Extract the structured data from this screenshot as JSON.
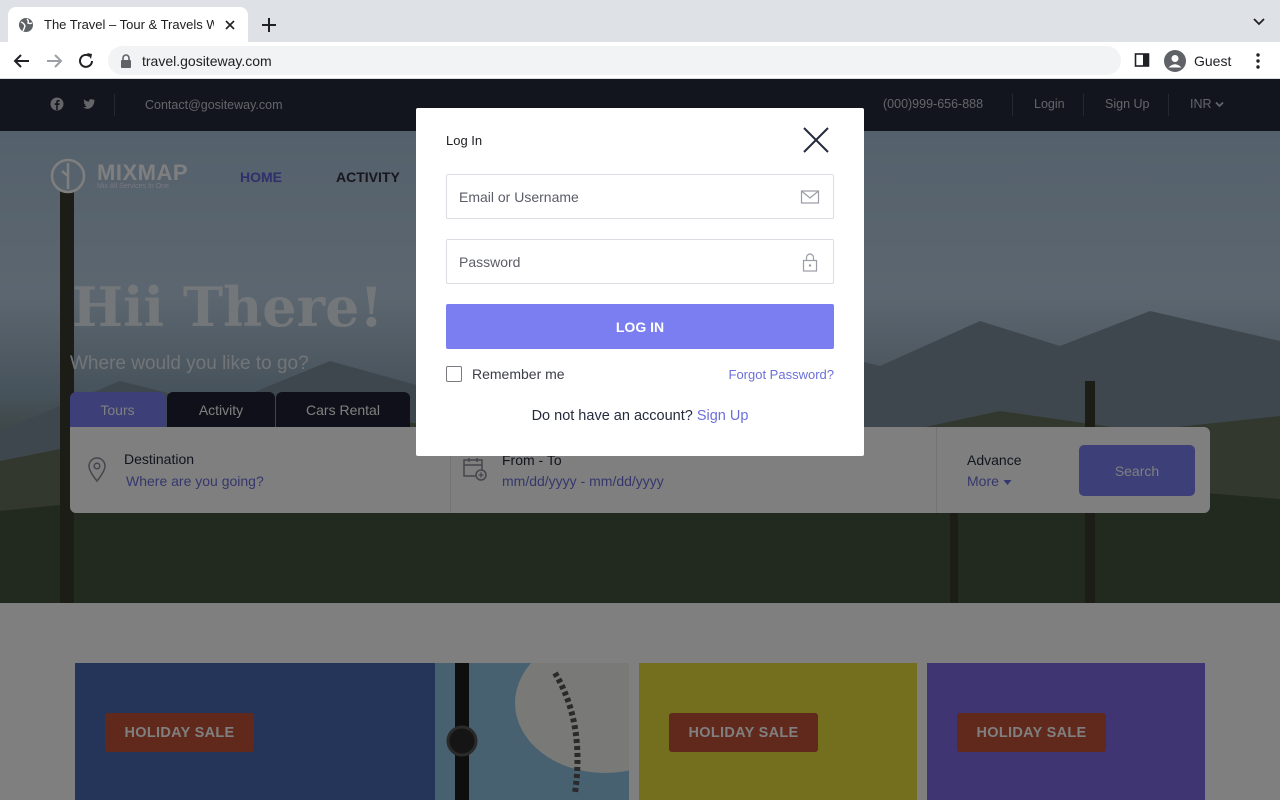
{
  "browser": {
    "tab_title": "The Travel – Tour & Travels We",
    "url": "travel.gositeway.com",
    "profile_label": "Guest"
  },
  "topbar": {
    "contact": "Contact@gositeway.com",
    "phone": "(000)999-656-888",
    "login": "Login",
    "signup": "Sign Up",
    "currency": "INR"
  },
  "header": {
    "logo_name": "MIXMAP",
    "logo_tagline": "Mix All Services In One",
    "menu": [
      "HOME",
      "ACTIVITY"
    ]
  },
  "hero": {
    "title": "Hii There!",
    "subtitle": "Where would you like to go?"
  },
  "search": {
    "tabs": [
      "Tours",
      "Activity",
      "Cars Rental"
    ],
    "destination_label": "Destination",
    "destination_value": "Where are you going?",
    "dates_label": "From - To",
    "dates_value": "mm/dd/yyyy - mm/dd/yyyy",
    "advance_label": "Advance",
    "more_label": "More",
    "search_button": "Search"
  },
  "promos": [
    {
      "badge": "HOLIDAY SALE",
      "color": "#4a6bb5"
    },
    {
      "badge": "HOLIDAY SALE",
      "color": "#e7df3f"
    },
    {
      "badge": "HOLIDAY SALE",
      "color": "#7f6ae6"
    }
  ],
  "modal": {
    "title": "Log In",
    "email_placeholder": "Email or Username",
    "password_placeholder": "Password",
    "login_button": "LOG IN",
    "remember_label": "Remember me",
    "forgot_label": "Forgot Password?",
    "no_account_text": "Do not have an account?",
    "signup_link": "Sign Up"
  },
  "colors": {
    "accent": "#7a7ef0",
    "topbar": "#262a3c",
    "sale_badge": "#c05236"
  }
}
